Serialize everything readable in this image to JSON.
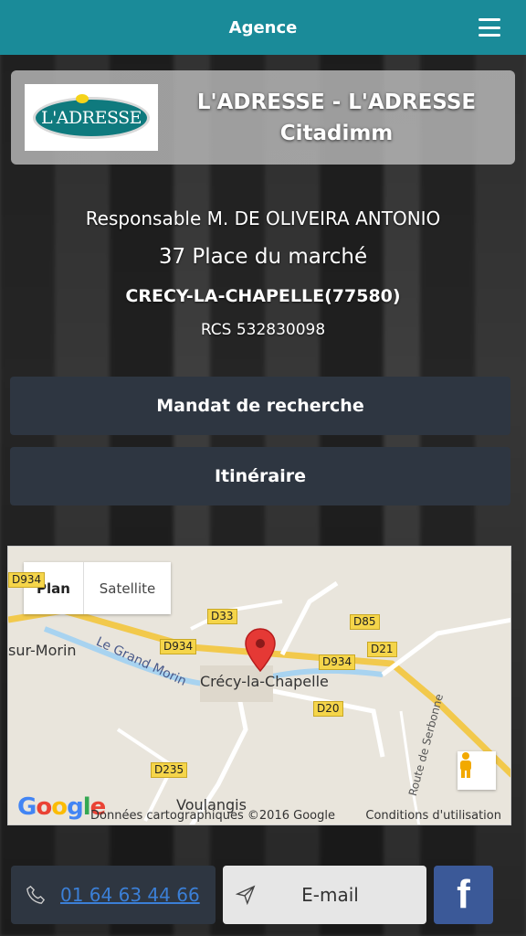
{
  "topbar": {
    "title": "Agence",
    "menu_icon": "hamburger-menu-icon"
  },
  "agency": {
    "logo_text": "L'ADRESSE",
    "name_line1": "L'ADRESSE - L'ADRESSE",
    "name_line2": "Citadimm"
  },
  "info": {
    "responsable": "Responsable M. DE OLIVEIRA ANTONIO",
    "street": "37 Place du marché",
    "city": "CRECY-LA-CHAPELLE(77580)",
    "rcs": "RCS 532830098"
  },
  "actions": {
    "mandat": "Mandat de recherche",
    "itineraire": "Itinéraire"
  },
  "map": {
    "type_plan": "Plan",
    "type_satellite": "Satellite",
    "roads": [
      "D934",
      "D33",
      "D85",
      "D934",
      "D21",
      "D934",
      "D20",
      "D235"
    ],
    "places": {
      "crecy": "Crécy-la-Chapelle",
      "sur_morin": "sur-Morin",
      "grand_morin": "Le Grand Morin",
      "voulangis": "Voulangis",
      "serbonne": "Route de Serbonne"
    },
    "google": "Google",
    "attribution": "Données cartographiques ©2016 Google",
    "conditions": "Conditions d'utilisation"
  },
  "contact": {
    "phone": "01 64 63 44 66",
    "email_label": "E-mail",
    "facebook": "f"
  },
  "colors": {
    "topbar": "#1a8b99",
    "button_dark": "#2e3641",
    "facebook": "#3b5998",
    "link": "#3b7fd6"
  }
}
